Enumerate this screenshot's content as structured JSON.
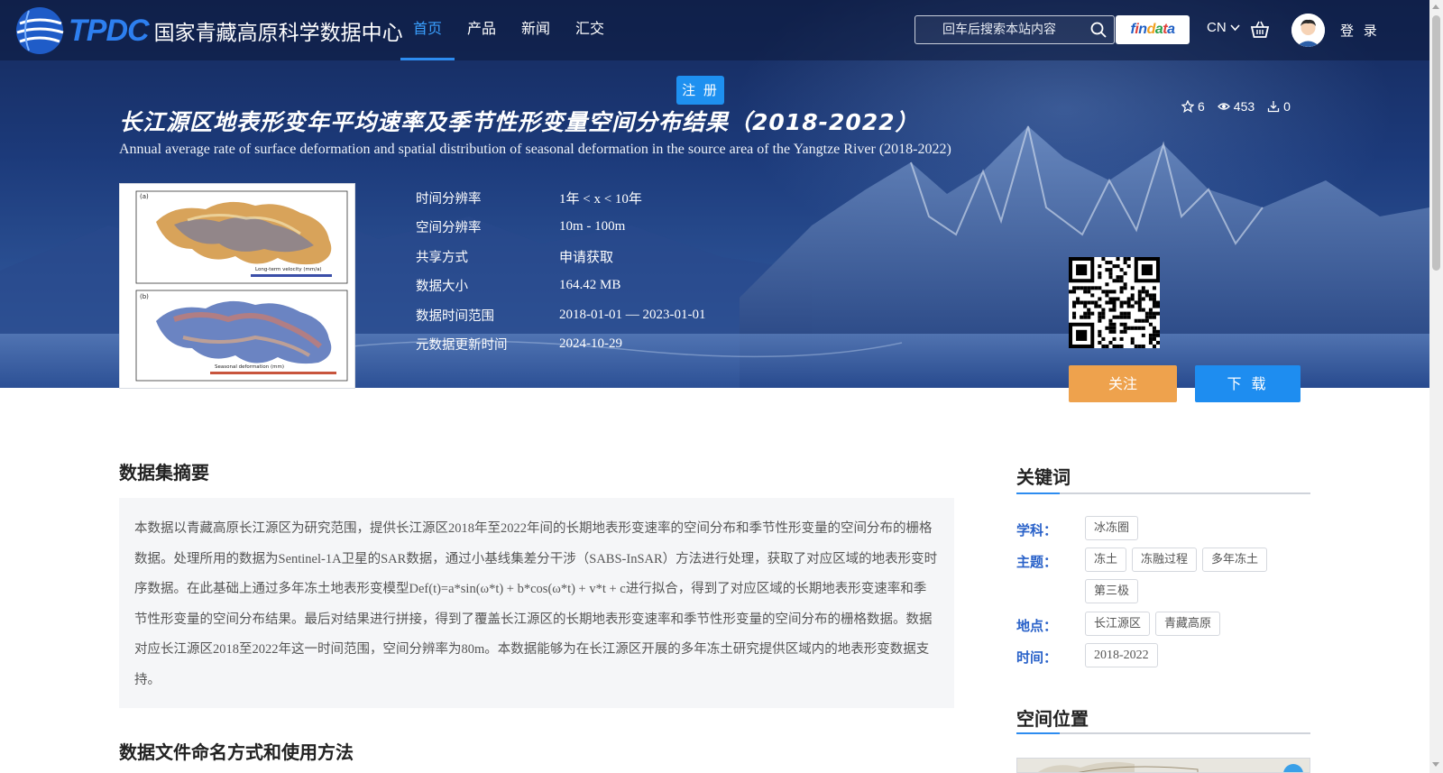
{
  "header": {
    "logo_text": "TPDC",
    "site_name": "国家青藏高原科学数据中心",
    "nav": [
      {
        "label": "首页"
      },
      {
        "label": "产品"
      },
      {
        "label": "新闻"
      },
      {
        "label": "汇交"
      }
    ],
    "search_placeholder": "回车后搜索本站内容",
    "findata_letters": [
      "f",
      "i",
      "n",
      "d",
      "a",
      "t",
      "a"
    ],
    "findata_colors": [
      "#1f5fc4",
      "#e0403a",
      "#1f5fc4",
      "#f0a020",
      "#2aa14b",
      "#e0403a",
      "#1f5fc4"
    ],
    "lang": "CN",
    "login_label": "登 录",
    "register_label": "注 册"
  },
  "dataset": {
    "title_cn": "长江源区地表形变年平均速率及季节性形变量空间分布结果（2018-2022）",
    "title_en": "Annual average rate of surface deformation and spatial distribution of seasonal deformation in the source area of the Yangtze River (2018-2022)",
    "stats": {
      "stars": "6",
      "views": "453",
      "downloads": "0"
    },
    "meta": [
      {
        "key": "时间分辨率",
        "value": "1年 < x < 10年"
      },
      {
        "key": "空间分辨率",
        "value": "10m - 100m"
      },
      {
        "key": "共享方式",
        "value": "申请获取"
      },
      {
        "key": "数据大小",
        "value": "164.42 MB"
      },
      {
        "key": "数据时间范围",
        "value": "2018-01-01 — 2023-01-01"
      },
      {
        "key": "元数据更新时间",
        "value": "2024-10-29"
      }
    ],
    "thumbnail": {
      "panel_a_label": "(a)",
      "panel_b_label": "(b)",
      "legend_a": "Long-term velocity (mm/a)",
      "legend_b": "Seasonal deformation (mm)"
    },
    "follow_label": "关注",
    "download_label": "下 载"
  },
  "abstract": {
    "title": "数据集摘要",
    "text": "本数据以青藏高原长江源区为研究范围，提供长江源区2018年至2022年间的长期地表形变速率的空间分布和季节性形变量的空间分布的栅格数据。处理所用的数据为Sentinel-1A卫星的SAR数据，通过小基线集差分干涉（SABS-InSAR）方法进行处理，获取了对应区域的地表形变时序数据。在此基础上通过多年冻土地表形变模型Def(t)=a*sin(ω*t) + b*cos(ω*t) + v*t + c进行拟合，得到了对应区域的长期地表形变速率和季节性形变量的空间分布结果。最后对结果进行拼接，得到了覆盖长江源区的长期地表形变速率和季节性形变量的空间分布的栅格数据。数据对应长江源区2018至2022年这一时间范围，空间分辨率为80m。本数据能够为在长江源区开展的多年冻土研究提供区域内的地表形变数据支持。"
  },
  "file_naming": {
    "title": "数据文件命名方式和使用方法"
  },
  "keywords": {
    "title": "关键词",
    "groups": [
      {
        "label": "学科：",
        "tags": [
          "冰冻圈"
        ]
      },
      {
        "label": "主题：",
        "tags": [
          "冻土",
          "冻融过程",
          "多年冻土",
          "第三极"
        ]
      },
      {
        "label": "地点：",
        "tags": [
          "长江源区",
          "青藏高原"
        ]
      },
      {
        "label": "时间：",
        "tags": [
          "2018-2022"
        ]
      }
    ]
  },
  "spatial": {
    "title": "空间位置"
  },
  "colors": {
    "accent": "#2d8cf0",
    "follow": "#eea24d",
    "download": "#1e8df0",
    "keyword_label": "#2a62c9"
  }
}
